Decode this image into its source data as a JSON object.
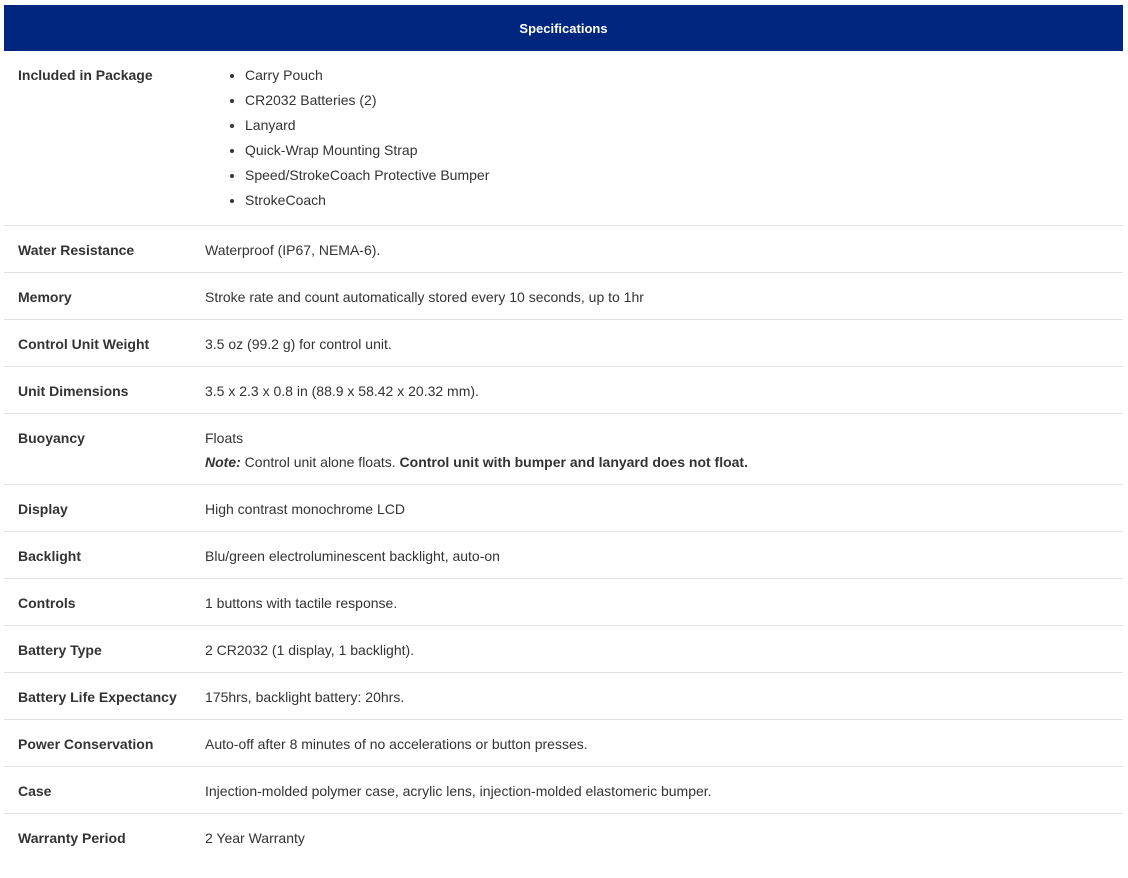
{
  "header": {
    "title": "Specifications"
  },
  "package": {
    "label": "Included in Package",
    "items": [
      "Carry Pouch",
      "CR2032 Batteries (2)",
      "Lanyard",
      "Quick-Wrap Mounting Strap",
      "Speed/StrokeCoach Protective Bumper",
      "StrokeCoach"
    ]
  },
  "rows": {
    "water_resistance": {
      "label": "Water Resistance",
      "value": "Waterproof (IP67, NEMA-6)."
    },
    "memory": {
      "label": "Memory",
      "value": "Stroke rate and count automatically stored every 10 seconds, up to 1hr"
    },
    "weight": {
      "label": "Control Unit Weight",
      "value": "3.5 oz (99.2 g) for control unit."
    },
    "dimensions": {
      "label": "Unit Dimensions",
      "value": "3.5 x 2.3 x 0.8 in (88.9 x 58.42 x 20.32 mm)."
    },
    "buoyancy": {
      "label": "Buoyancy",
      "value": "Floats",
      "note_label": "Note:",
      "note_text": " Control unit alone floats. ",
      "note_bold": "Control unit with bumper and lanyard does not float."
    },
    "display": {
      "label": "Display",
      "value": "High contrast monochrome LCD"
    },
    "backlight": {
      "label": "Backlight",
      "value": "Blu/green electroluminescent backlight, auto-on"
    },
    "controls": {
      "label": "Controls",
      "value": "1 buttons with tactile response."
    },
    "battery_type": {
      "label": "Battery Type",
      "value": "2 CR2032 (1 display, 1 backlight)."
    },
    "battery_life": {
      "label": "Battery Life Expectancy",
      "value": "175hrs, backlight battery: 20hrs."
    },
    "power": {
      "label": "Power Conservation",
      "value": "Auto-off after 8 minutes of no accelerations or button presses."
    },
    "case": {
      "label": "Case",
      "value": "Injection-molded polymer case, acrylic lens, injection-molded elastomeric bumper."
    },
    "warranty": {
      "label": "Warranty Period",
      "value": "2 Year Warranty"
    }
  },
  "colors": {
    "header_bg": "#002680",
    "header_text": "#ffffff",
    "divider": "#e2e2e2",
    "text": "#333333"
  }
}
